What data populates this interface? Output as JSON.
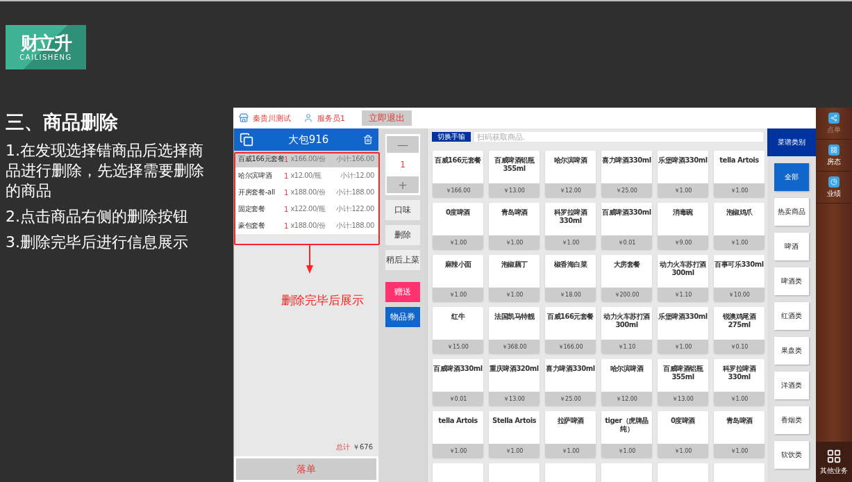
{
  "slide": {
    "logo": {
      "mark": "财立升",
      "wordmark": "CAILISHENG"
    },
    "title": "三、商品删除",
    "steps": [
      "1.在发现选择错商品后选择商品进行删除，先选择需要删除的商品",
      "2.点击商品右侧的删除按钮",
      "3.删除完毕后进行信息展示"
    ],
    "annotation": "删除完毕后展示"
  },
  "app": {
    "top_bar": {
      "store": "秦贵川测试",
      "waiter": "服务员1",
      "exit_button": "立即退出"
    },
    "order": {
      "table": "大包916",
      "items": [
        {
          "name": "百威166元套餐",
          "qty": "1",
          "unit_price": "x166.00/份",
          "subtotal": "小计:166.00",
          "selected": true
        },
        {
          "name": "哈尔滨啤酒",
          "qty": "1",
          "unit_price": "x12.00/瓶",
          "subtotal": "小计:12.00",
          "selected": false
        },
        {
          "name": "开房套餐-all",
          "qty": "1",
          "unit_price": "x188.00/份",
          "subtotal": "小计:188.00",
          "selected": false
        },
        {
          "name": "固定套餐",
          "qty": "1",
          "unit_price": "x122.00/瓶",
          "subtotal": "小计:122.00",
          "selected": false
        },
        {
          "name": "豪包套餐",
          "qty": "1",
          "unit_price": "x188.00/份",
          "subtotal": "小计:188.00",
          "selected": false
        }
      ],
      "total_label": "总计",
      "total": "￥676",
      "submit": "落单"
    },
    "actions": {
      "minus": "—",
      "quantity": "1",
      "plus": "+",
      "buttons": [
        {
          "label": "口味",
          "kind": "plain"
        },
        {
          "label": "删除",
          "kind": "plain"
        },
        {
          "label": "稍后上菜",
          "kind": "plain"
        },
        {
          "label": "赠送",
          "kind": "gift"
        },
        {
          "label": "物品券",
          "kind": "voucher"
        }
      ]
    },
    "search": {
      "switch_button": "切换手输",
      "placeholder": "扫码获取商品."
    },
    "products": [
      {
        "name": "百威166元套餐",
        "price": "￥166.00"
      },
      {
        "name": "百威啤酒铝瓶355ml",
        "price": "￥13.00"
      },
      {
        "name": "哈尔滨啤酒",
        "price": "￥12.00"
      },
      {
        "name": "喜力啤酒330ml",
        "price": "￥25.00"
      },
      {
        "name": "乐堡啤酒330ml",
        "price": "￥1.00"
      },
      {
        "name": "tella Artois",
        "price": "￥1.00"
      },
      {
        "name": "0度啤酒",
        "price": "￥1.00"
      },
      {
        "name": "青岛啤酒",
        "price": "￥1.00"
      },
      {
        "name": "科罗拉啤酒330ml",
        "price": "￥1.00"
      },
      {
        "name": "百威啤酒330ml",
        "price": "￥0.01"
      },
      {
        "name": "消毒碗",
        "price": "￥9.00"
      },
      {
        "name": "泡椒鸡爪",
        "price": "￥1.00"
      },
      {
        "name": "麻辣小面",
        "price": "￥1.00"
      },
      {
        "name": "泡椒藕丁",
        "price": "￥1.00"
      },
      {
        "name": "椒香海白菜",
        "price": "￥18.00"
      },
      {
        "name": "大房套餐",
        "price": "￥200.00"
      },
      {
        "name": "动力火车苏打酒300ml",
        "price": "￥1.10"
      },
      {
        "name": "百事可乐330ml",
        "price": "￥10.00"
      },
      {
        "name": "红牛",
        "price": "￥15.00"
      },
      {
        "name": "法国凯马特靓",
        "price": "￥368.00"
      },
      {
        "name": "百威166元套餐",
        "price": "￥166.00"
      },
      {
        "name": "动力火车苏打酒300ml",
        "price": "￥1.10"
      },
      {
        "name": "乐堡啤酒330ml",
        "price": "￥1.00"
      },
      {
        "name": "锐澳鸡尾酒275ml",
        "price": "￥0.10"
      },
      {
        "name": "百威啤酒330ml",
        "price": "￥0.01"
      },
      {
        "name": "重庆啤酒320ml",
        "price": "￥13.00"
      },
      {
        "name": "喜力啤酒330ml",
        "price": "￥25.00"
      },
      {
        "name": "哈尔滨啤酒",
        "price": "￥12.00"
      },
      {
        "name": "百威啤酒铝瓶355ml",
        "price": "￥13.00"
      },
      {
        "name": "科罗拉啤酒330ml",
        "price": "￥1.00"
      },
      {
        "name": "tella Artois",
        "price": "￥1.00"
      },
      {
        "name": "Stella Artois",
        "price": "￥1.00"
      },
      {
        "name": "拉萨啤酒",
        "price": "￥1.00"
      },
      {
        "name": "tiger（虎牌晶纯）",
        "price": "￥1.00"
      },
      {
        "name": "0度啤酒",
        "price": "￥1.00"
      },
      {
        "name": "青岛啤酒",
        "price": "￥1.00"
      }
    ],
    "categories": {
      "header": "菜谱类别",
      "items": [
        {
          "label": "全部",
          "selected": true
        },
        {
          "label": "热卖商品",
          "selected": false
        },
        {
          "label": "啤酒",
          "selected": false
        },
        {
          "label": "啤酒类",
          "selected": false
        },
        {
          "label": "红酒类",
          "selected": false
        },
        {
          "label": "果盘类",
          "selected": false
        },
        {
          "label": "洋酒类",
          "selected": false
        },
        {
          "label": "香烟类",
          "selected": false
        },
        {
          "label": "软饮类",
          "selected": false
        }
      ]
    },
    "nav": {
      "items": [
        {
          "label": "点单",
          "selected": true
        },
        {
          "label": "房态",
          "selected": false
        },
        {
          "label": "业绩",
          "selected": false
        }
      ],
      "more": "其他业务"
    }
  }
}
